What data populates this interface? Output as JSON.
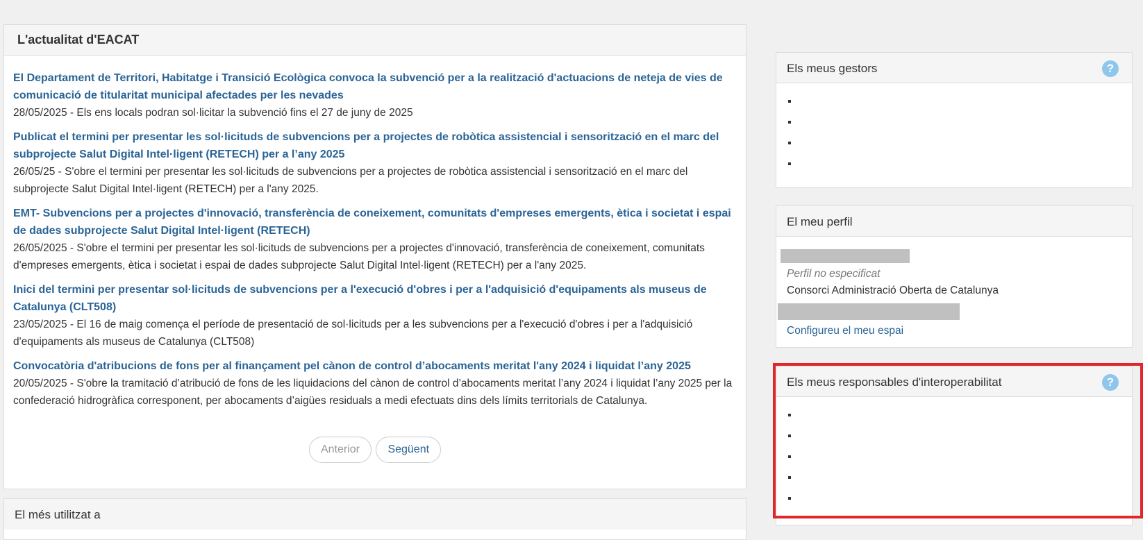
{
  "news": {
    "title": "L'actualitat d'EACAT",
    "items": [
      {
        "title": "El Departament de Territori, Habitatge i Transició Ecològica convoca la subvenció per a la realització d'actuacions de neteja de vies de comunicació de titularitat municipal afectades per les nevades",
        "desc": "28/05/2025 - Els ens locals podran sol·licitar la subvenció fins el 27 de juny de 2025"
      },
      {
        "title": "Publicat el termini per presentar les sol·licituds de subvencions per a projectes de robòtica assistencial i sensorització en el marc del subprojecte Salut Digital Intel·ligent (RETECH) per a l’any 2025",
        "desc": "26/05/25 - S'obre el termini per presentar les sol·licituds de subvencions per a projectes de robòtica assistencial i sensorització en el marc del subprojecte Salut Digital Intel·ligent (RETECH) per a l'any 2025."
      },
      {
        "title": "EMT- Subvencions per a projectes d'innovació, transferència de coneixement, comunitats d'empreses emergents, ètica i societat i espai de dades subprojecte Salut Digital Intel·ligent (RETECH)",
        "desc": "26/05/2025 - S'obre el termini per presentar les sol·licituds de subvencions per a projectes d'innovació, transferència de coneixement, comunitats d'empreses emergents, ètica i societat i espai de dades subprojecte Salut Digital Intel·ligent (RETECH) per a l'any 2025."
      },
      {
        "title": "Inici del termini per presentar sol·licituds de subvencions per a l'execució d'obres i per a l'adquisició d'equipaments als museus de Catalunya (CLT508)",
        "desc": "23/05/2025 - El 16 de maig comença el període de presentació de sol·licituds per a les subvencions per a l'execució d'obres i per a l'adquisició d'equipaments als museus de Catalunya (CLT508)"
      },
      {
        "title": "Convocatòria d'atribucions de fons per al finançament pel cànon de control d’abocaments meritat l'any 2024 i liquidat l’any 2025",
        "desc": "20/05/2025 - S'obre la tramitació d’atribució de fons de les liquidacions del cànon de control d’abocaments meritat l’any 2024 i liquidat l’any 2025 per la confederació hidrogràfica corresponent, per abocaments d’aigües residuals a medi efectuats dins dels límits territorials de Catalunya."
      }
    ],
    "pager": {
      "prev": "Anterior",
      "next": "Següent"
    }
  },
  "more_used": {
    "title": "El més utilitzat a"
  },
  "gestors": {
    "title": "Els meus gestors",
    "help": "?"
  },
  "perfil": {
    "title": "El meu perfil",
    "type": "Perfil no especificat",
    "org": "Consorci Administració Oberta de Catalunya",
    "link": "Configureu el meu espai"
  },
  "interop": {
    "title": "Els meus responsables d'interoperabilitat",
    "help": "?"
  },
  "colors": {
    "link": "#2a6496",
    "highlight": "#e0262b",
    "help": "#8ec6ec"
  }
}
